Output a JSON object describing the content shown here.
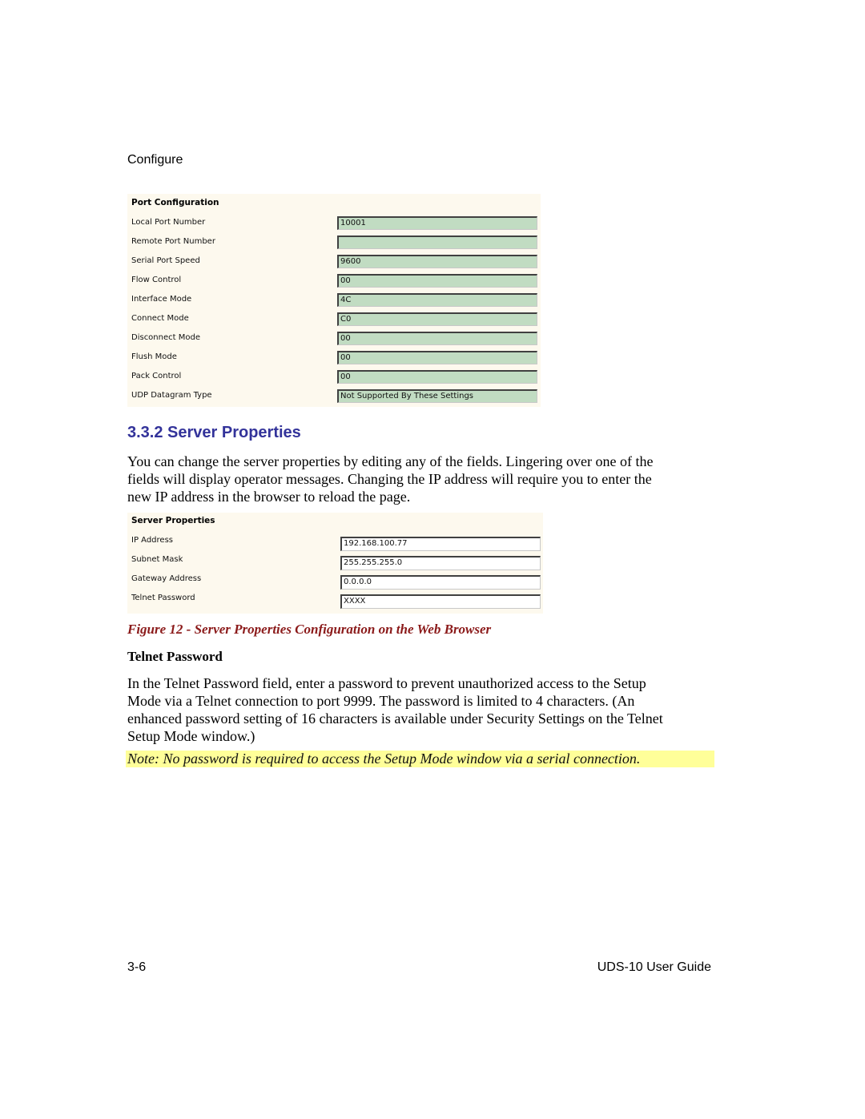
{
  "running_header": "Configure",
  "port_configuration": {
    "title": "Port Configuration",
    "rows": [
      {
        "label": "Local Port Number",
        "value": "10001"
      },
      {
        "label": "Remote Port Number",
        "value": ""
      },
      {
        "label": "Serial Port Speed",
        "value": "9600"
      },
      {
        "label": "Flow Control",
        "value": "00"
      },
      {
        "label": "Interface Mode",
        "value": "4C"
      },
      {
        "label": "Connect Mode",
        "value": "C0"
      },
      {
        "label": "Disconnect Mode",
        "value": "00"
      },
      {
        "label": "Flush Mode",
        "value": "00"
      },
      {
        "label": "Pack Control",
        "value": "00"
      },
      {
        "label": "UDP Datagram Type",
        "value": "Not Supported By These Settings"
      }
    ]
  },
  "section": {
    "heading": "3.3.2 Server Properties",
    "intro_lines": [
      "You can change the server properties by editing any of the fields. Lingering over one of the",
      "fields will display operator messages. Changing the IP address will require you to enter the",
      "new IP address in the browser to reload the page."
    ]
  },
  "server_properties": {
    "title": "Server Properties",
    "rows": [
      {
        "label": "IP Address",
        "value": "192.168.100.77"
      },
      {
        "label": "Subnet Mask",
        "value": "255.255.255.0"
      },
      {
        "label": "Gateway Address",
        "value": "0.0.0.0"
      },
      {
        "label": "Telnet Password",
        "value": "XXXX"
      }
    ]
  },
  "figure_caption": "Figure 12 - Server Properties Configuration on the Web Browser",
  "telnet_password": {
    "heading": "Telnet Password",
    "body_lines": [
      "In the Telnet Password field, enter a password to prevent unauthorized access to the Setup",
      "Mode via a Telnet connection to port 9999. The password is limited to 4 characters. (An",
      "enhanced password setting of 16 characters is available under Security Settings on the Telnet",
      "Setup Mode window.)"
    ]
  },
  "note": "Note: No password is required to access the Setup Mode window via a serial connection.",
  "footer": {
    "page_number": "3-6",
    "guide_title": "UDS-10 User Guide"
  }
}
